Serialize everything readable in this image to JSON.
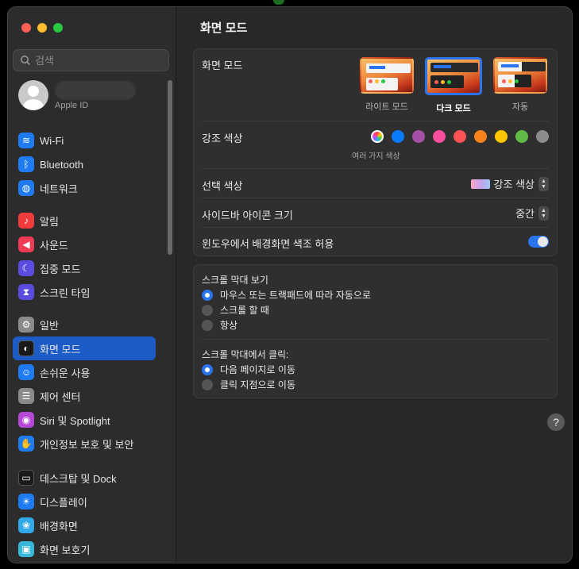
{
  "sidebar": {
    "search_placeholder": "검색",
    "apple_id_sub": "Apple ID",
    "groups": [
      [
        {
          "name": "wifi",
          "label": "Wi-Fi",
          "icon": "wifi-icon",
          "color": "#1e7bf2",
          "glyph": "≋"
        },
        {
          "name": "bluetooth",
          "label": "Bluetooth",
          "icon": "bluetooth-icon",
          "color": "#1e7bf2",
          "glyph": "ᛒ"
        },
        {
          "name": "network",
          "label": "네트워크",
          "icon": "globe-icon",
          "color": "#1e7bf2",
          "glyph": "◍"
        }
      ],
      [
        {
          "name": "notifications",
          "label": "알림",
          "icon": "bell-icon",
          "color": "#ef3b3b",
          "glyph": "♪"
        },
        {
          "name": "sound",
          "label": "사운드",
          "icon": "speaker-icon",
          "color": "#ef3b55",
          "glyph": "◀"
        },
        {
          "name": "focus",
          "label": "집중 모드",
          "icon": "moon-icon",
          "color": "#5b4ce0",
          "glyph": "☾"
        },
        {
          "name": "screen-time",
          "label": "스크린 타임",
          "icon": "hourglass-icon",
          "color": "#5b4ce0",
          "glyph": "⧗"
        }
      ],
      [
        {
          "name": "general",
          "label": "일반",
          "icon": "gear-icon",
          "color": "#8a8a8a",
          "glyph": "⚙"
        },
        {
          "name": "appearance",
          "label": "화면 모드",
          "icon": "appearance-icon",
          "color": "#1a1a1a",
          "glyph": "◐",
          "active": true
        },
        {
          "name": "accessibility",
          "label": "손쉬운 사용",
          "icon": "accessibility-icon",
          "color": "#1e7bf2",
          "glyph": "☺"
        },
        {
          "name": "control-center",
          "label": "제어 센터",
          "icon": "toggles-icon",
          "color": "#8a8a8a",
          "glyph": "☰"
        },
        {
          "name": "siri",
          "label": "Siri 및 Spotlight",
          "icon": "siri-icon",
          "color": "#b548d6",
          "glyph": "◉"
        },
        {
          "name": "privacy",
          "label": "개인정보 보호 및 보안",
          "icon": "hand-icon",
          "color": "#1e7bf2",
          "glyph": "✋"
        }
      ],
      [
        {
          "name": "desktop-dock",
          "label": "데스크탑 및 Dock",
          "icon": "dock-icon",
          "color": "#1a1a1a",
          "glyph": "▭"
        },
        {
          "name": "displays",
          "label": "디스플레이",
          "icon": "sun-icon",
          "color": "#1e7bf2",
          "glyph": "☀"
        },
        {
          "name": "wallpaper",
          "label": "배경화면",
          "icon": "flower-icon",
          "color": "#32a8e8",
          "glyph": "❀"
        },
        {
          "name": "screensaver",
          "label": "화면 보호기",
          "icon": "screensaver-icon",
          "color": "#38b8d8",
          "glyph": "▣"
        }
      ]
    ]
  },
  "main": {
    "title": "화면 모드",
    "appearance": {
      "label": "화면 모드",
      "options": [
        {
          "name": "light",
          "label": "라이트 모드"
        },
        {
          "name": "dark",
          "label": "다크 모드",
          "selected": true
        },
        {
          "name": "auto",
          "label": "자동"
        }
      ]
    },
    "accent": {
      "label": "강조 색상",
      "caption": "여러 가지 색상",
      "colors": [
        "multicolor",
        "#0a7aff",
        "#a550a7",
        "#f74f9e",
        "#ff5257",
        "#f7821b",
        "#ffc600",
        "#62ba46",
        "#8c8c8c"
      ]
    },
    "highlight": {
      "label": "선택 색상",
      "value": "강조 색상"
    },
    "sidebar_icon_size": {
      "label": "사이드바 아이콘 크기",
      "value": "중간"
    },
    "wallpaper_tint": {
      "label": "윈도우에서 배경화면 색조 허용",
      "on": true
    },
    "scroll": {
      "show_label": "스크롤 막대 보기",
      "show_options": [
        {
          "label": "마우스 또는 트랙패드에 따라 자동으로",
          "on": true
        },
        {
          "label": "스크롤 할 때",
          "on": false
        },
        {
          "label": "항상",
          "on": false
        }
      ],
      "click_label": "스크롤 막대에서 클릭:",
      "click_options": [
        {
          "label": "다음 페이지로 이동",
          "on": true
        },
        {
          "label": "클릭 지점으로 이동",
          "on": false
        }
      ]
    },
    "help": "?"
  }
}
